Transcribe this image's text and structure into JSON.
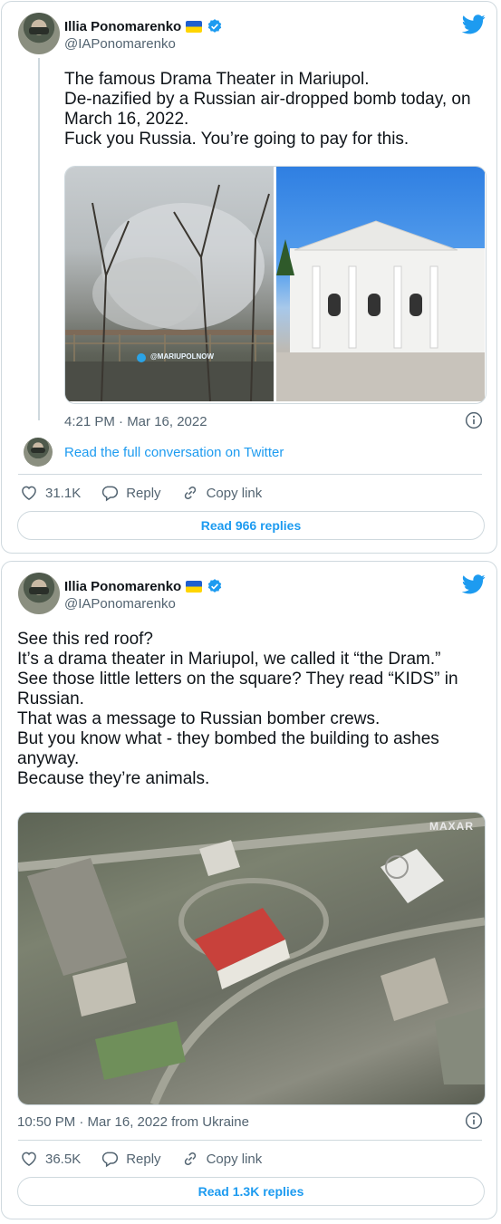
{
  "tweet1": {
    "author": {
      "name": "Illia Ponomarenko",
      "handle": "@IAPonomarenko"
    },
    "text": "The famous Drama Theater in Mariupol.\nDe-nazified by a Russian air-dropped bomb today, on March 16, 2022.\nFuck you Russia. You’re going to pay for this.",
    "photo_watermark": "@MARIUPOLNOW",
    "timestamp": "4:21 PM · Mar 16, 2022",
    "conversation_link": "Read the full conversation on Twitter",
    "likes": "31.1K",
    "reply_label": "Reply",
    "copy_link_label": "Copy link",
    "replies_button": "Read 966 replies"
  },
  "tweet2": {
    "author": {
      "name": "Illia Ponomarenko",
      "handle": "@IAPonomarenko"
    },
    "text": "See this red roof?\nIt’s a drama theater in Mariupol, we called it “the Dram.”\nSee those little letters on the square? They read “KIDS” in Russian.\nThat was a message to Russian bomber crews.\nBut you know what - they bombed the building to ashes anyway.\nBecause they’re animals.",
    "photo_watermark": "MAXAR",
    "timestamp": "10:50 PM · Mar 16, 2022 from Ukraine",
    "likes": "36.5K",
    "reply_label": "Reply",
    "copy_link_label": "Copy link",
    "replies_button": "Read 1.3K replies"
  },
  "colors": {
    "accent": "#1d9bf0",
    "secondary_text": "#536471",
    "border": "#cfd9de"
  }
}
